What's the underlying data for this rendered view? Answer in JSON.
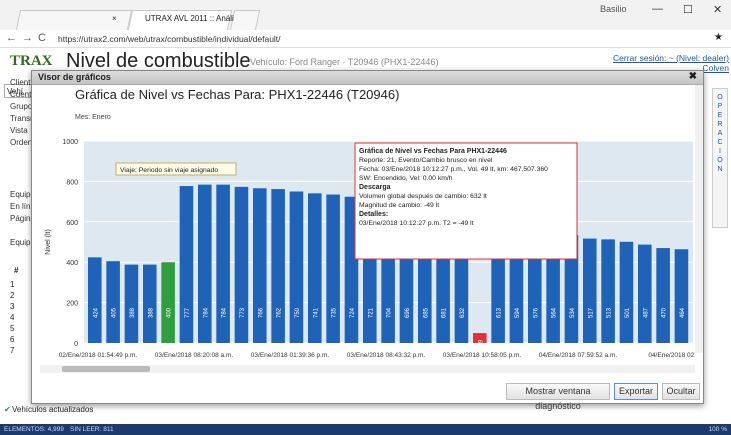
{
  "browser": {
    "tab_title": "UTRAX AVL 2011 :: Análi",
    "tab_close": "×",
    "user": "Basilio",
    "url": "https://utrax2.com/web/utrax/combustible/individual/default/",
    "minimize": "—",
    "maximize": "☐",
    "close": "✕"
  },
  "app": {
    "logo": "TRAX",
    "title": "Nivel de combustible",
    "subtitle": "Vehículo: Ford Ranger · T20946 (PHX1-22446)",
    "logout": "Cerrar sesión: ~ (Nivel: dealer)",
    "user_link": "Colven",
    "side_tab": "Vehí",
    "side_labels": [
      "Client",
      "Cuent",
      "Grupo",
      "Transr",
      "Vista",
      "Orden",
      "Equipo",
      "En lín",
      "Página",
      "Equip"
    ],
    "row_header": "#",
    "row_numbers": [
      "1",
      "2",
      "3",
      "4",
      "5",
      "6",
      "7"
    ],
    "operaciones": "OPERACIÓN",
    "status_text": "Vehículos actualizados"
  },
  "modal": {
    "title": "Visor de gráficos",
    "close": "✖",
    "buttons": {
      "diagnostico": "Mostrar ventana diagnóstico",
      "exportar": "Exportar",
      "ocultar": "Ocultar"
    }
  },
  "chart_data": {
    "type": "bar",
    "title": "Gráfica de Nivel vs Fechas Para: PHX1-22446 (T20946)",
    "month_label": "Mes: Enero",
    "ylabel": "Nivel (lt)",
    "ylim": [
      0,
      1000
    ],
    "yticks": [
      0,
      200,
      400,
      600,
      800,
      1000
    ],
    "grid": true,
    "values": [
      424,
      405,
      388,
      388,
      400,
      777,
      784,
      784,
      773,
      766,
      762,
      750,
      741,
      735,
      724,
      721,
      704,
      696,
      685,
      681,
      632,
      49,
      613,
      594,
      576,
      564,
      534,
      517,
      513,
      501,
      487,
      470,
      464
    ],
    "highlight_colors": {
      "21": "#e0303a",
      "4": "#2e9e3f"
    },
    "xtick_labels": [
      "02/Ene/2018 01:54:49 p.m.",
      "03/Ene/2018 08:20:08 a.m.",
      "03/Ene/2018 01:39:36 p.m.",
      "03/Ene/2018 08:43:32 p.m.",
      "03/Ene/2018 10:58:05 p.m.",
      "04/Ene/2018 07:59:52 a.m.",
      "04/Ene/2018 02:3"
    ],
    "annotation": "Viaje: Periodo sin viaje asignado",
    "tooltip": {
      "title": "Gráfica de Nivel vs Fechas Para PHX1-22446",
      "lines": [
        "Reporte: 21, Evento/Cambio brusco en nivel",
        "Fecha: 03/Ene/2018 10:12:27 p.m., Vol. 49 lt, km: 467,507.360",
        "SW: Encendido, Vel: 0.00 km/h"
      ],
      "section1": "Descarga",
      "lines2": [
        "Volumen global después de cambio: 632 lt",
        "Magnitud de cambio: -49 lt"
      ],
      "section2": "Detalles:",
      "lines3": [
        "03/Ene/2018 10:12:27 p.m. T2 = -49 lt"
      ]
    },
    "colors": {
      "bar": "#1f63b8",
      "plot_bg": "#dde8f0",
      "accent": "#e0303a"
    }
  },
  "statusbar": {
    "elementos": "ELEMENTOS: 4,999",
    "sin_leer": "SIN LEER: 811",
    "zoom": "100 %"
  }
}
